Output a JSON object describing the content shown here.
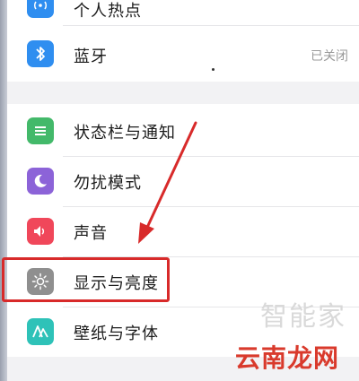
{
  "settings": {
    "items": [
      {
        "label": "个人热点",
        "value": ""
      },
      {
        "label": "蓝牙",
        "value": "已关闭"
      },
      {
        "label": "状态栏与通知",
        "value": ""
      },
      {
        "label": "勿扰模式",
        "value": ""
      },
      {
        "label": "声音",
        "value": ""
      },
      {
        "label": "显示与亮度",
        "value": ""
      },
      {
        "label": "壁纸与字体",
        "value": ""
      }
    ]
  },
  "icons": {
    "hotspot": {
      "name": "hotspot-icon",
      "color": "#2f8ef0"
    },
    "bluetooth": {
      "name": "bluetooth-icon",
      "color": "#2f8ef0"
    },
    "status_bar": {
      "name": "status-bar-icon",
      "color": "#43b96a"
    },
    "dnd": {
      "name": "moon-icon",
      "color": "#8c63d8"
    },
    "sound": {
      "name": "speaker-icon",
      "color": "#f0475a"
    },
    "display": {
      "name": "sun-icon",
      "color": "#8f8f8f"
    },
    "wallpaper": {
      "name": "font-icon",
      "color": "#2ec2b8"
    }
  },
  "annotation": {
    "color": "#d82a2a"
  },
  "watermark": {
    "light_text": "智能家",
    "main_text": "云南龙网"
  }
}
